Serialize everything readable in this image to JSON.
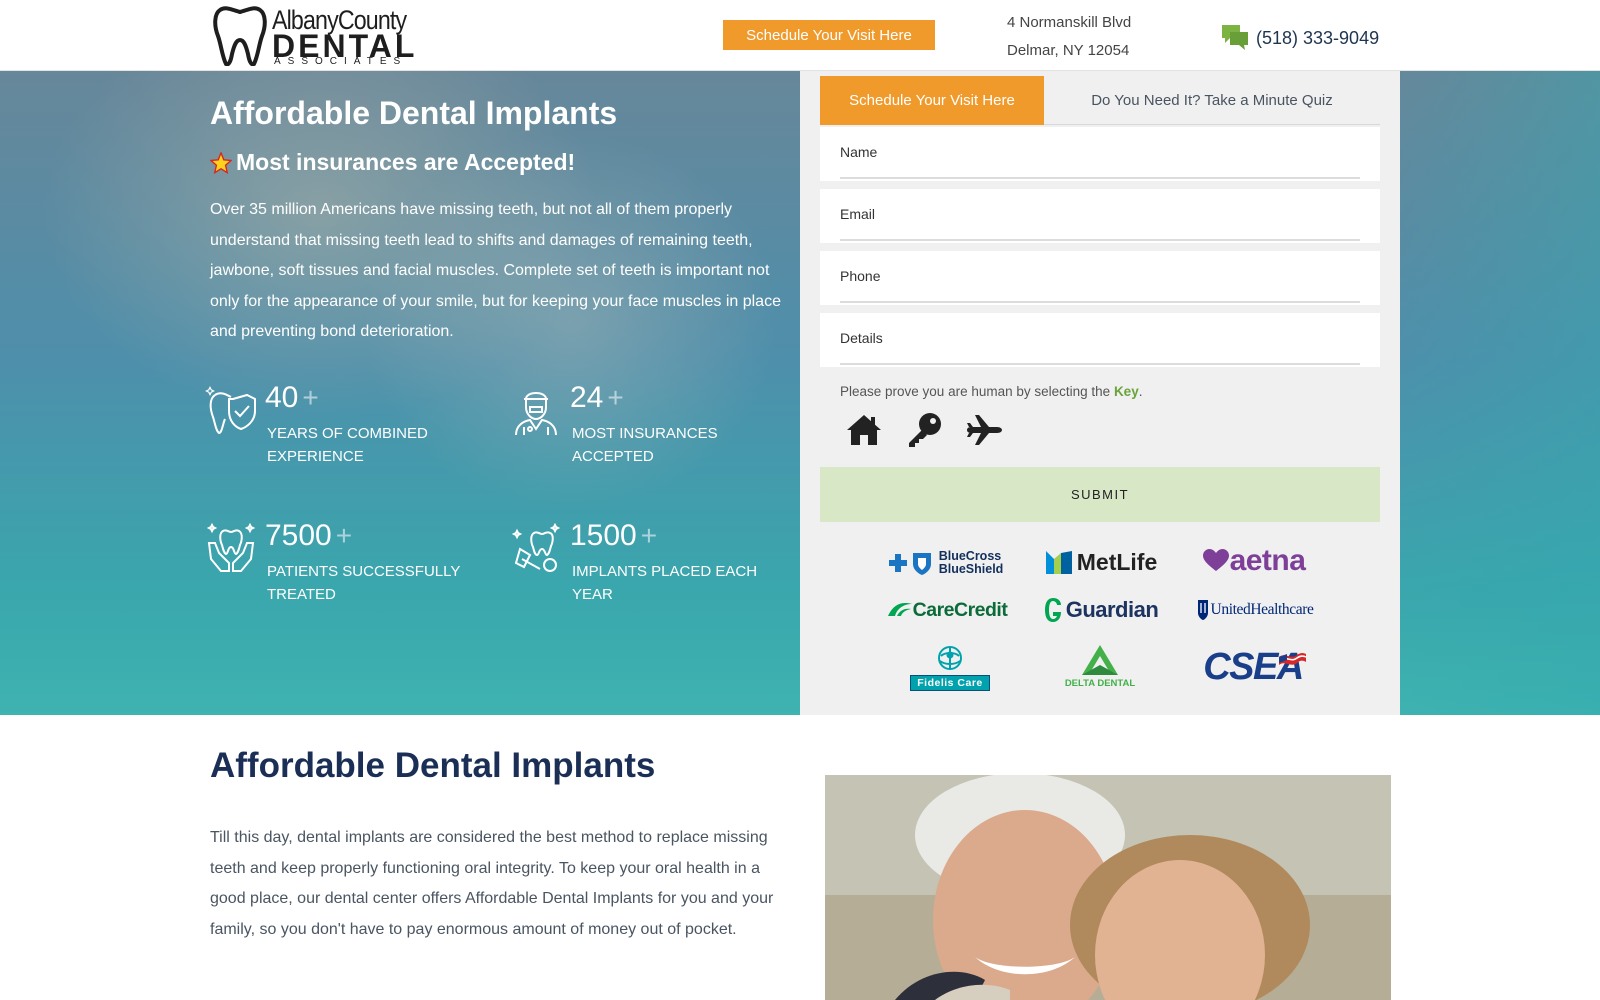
{
  "header": {
    "logo": {
      "line1": "AlbanyCounty",
      "line2": "DENTAL",
      "line3": "ASSOCIATES"
    },
    "cta_label": "Schedule Your Visit Here",
    "address_line1": "4 Normanskill Blvd",
    "address_line2": "Delmar, NY 12054",
    "phone": "(518) 333-9049"
  },
  "hero": {
    "title": "Affordable Dental Implants",
    "subtitle": "Most insurances are Accepted!",
    "paragraph": "Over 35 million Americans have missing teeth, but not all of them properly understand that missing teeth lead to shifts and damages of remaining teeth, jawbone, soft tissues and facial muscles. Complete set of teeth is important not only for the appearance of your smile, but for keeping your face muscles in place and preventing bond deterioration.",
    "stats": [
      {
        "number": "40",
        "plus": "+",
        "label": "Years of combined experience",
        "icon": "tooth-shield-icon"
      },
      {
        "number": "24",
        "plus": "+",
        "label": "Most insurances accepted",
        "icon": "dentist-icon"
      },
      {
        "number": "7500",
        "plus": "+",
        "label": "Patients successfully treated",
        "icon": "hands-tooth-icon"
      },
      {
        "number": "1500",
        "plus": "+",
        "label": "Implants placed each year",
        "icon": "implant-icon"
      }
    ]
  },
  "form": {
    "tabs": [
      {
        "label": "Schedule Your Visit Here",
        "active": true
      },
      {
        "label": "Do You Need It? Take a Minute Quiz",
        "active": false
      }
    ],
    "fields": [
      {
        "label": "Name",
        "value": ""
      },
      {
        "label": "Email",
        "value": ""
      },
      {
        "label": "Phone",
        "value": ""
      },
      {
        "label": "Details",
        "value": ""
      }
    ],
    "captcha": {
      "prompt": "Please prove you are human by selecting the",
      "keyword": "Key",
      "period": ".",
      "icons": [
        "home-icon",
        "key-icon",
        "airplane-icon"
      ]
    },
    "submit_label": "SUBMIT"
  },
  "insurances": {
    "bcbs": {
      "line1": "BlueCross",
      "line2": "BlueShield"
    },
    "metlife": "MetLife",
    "aetna": "aetna",
    "carecredit": "CareCredit",
    "guardian": "Guardian",
    "uhc": "UnitedHealthcare",
    "fidelis": "Fidelis Care",
    "delta": "DELTA DENTAL",
    "csea": "CSEA"
  },
  "section": {
    "title": "Affordable Dental Implants",
    "paragraph": "Till this day, dental implants are considered the best method to replace missing teeth and keep properly functioning oral integrity. To keep your oral health in a good place, our dental center offers Affordable Dental Implants for you and your family, so you don't have to pay enormous amount of money out of pocket."
  },
  "colors": {
    "accent_orange": "#ef9a2b",
    "navy": "#1b2f56",
    "submit_green": "#d8e8c6",
    "key_green": "#6aa33a"
  }
}
